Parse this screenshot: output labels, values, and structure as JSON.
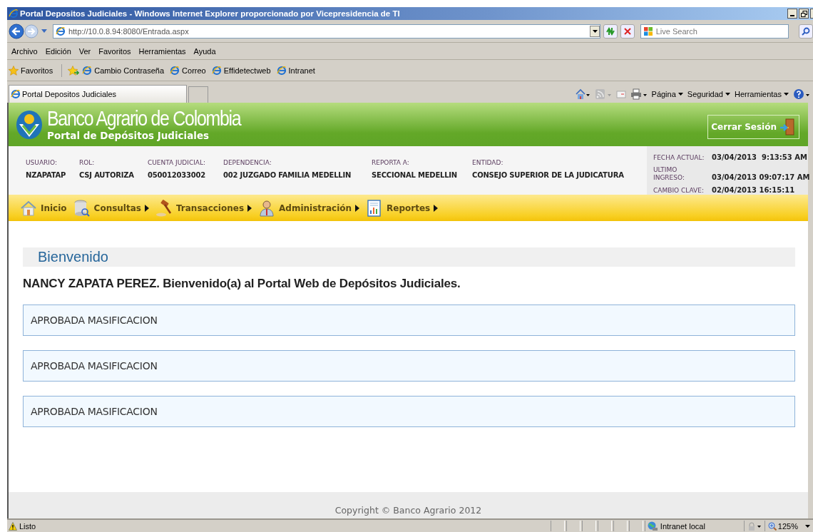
{
  "window": {
    "title": "Portal Depositos Judiciales - Windows Internet Explorer proporcionado por Vicepresidencia de TI"
  },
  "address_bar": {
    "url": "http://10.0.8.94:8080/Entrada.aspx"
  },
  "search": {
    "placeholder": "Live Search"
  },
  "menu_bar": [
    "Archivo",
    "Edición",
    "Ver",
    "Favoritos",
    "Herramientas",
    "Ayuda"
  ],
  "favorites_bar": {
    "label": "Favoritos",
    "links": [
      "Cambio Contraseña",
      "Correo",
      "Effidetectweb",
      "Intranet"
    ]
  },
  "tabs": [
    {
      "label": "Portal Depositos Judiciales",
      "selected": true
    }
  ],
  "command_bar": [
    "Página",
    "Seguridad",
    "Herramientas"
  ],
  "portal": {
    "bank_name": "Banco Agrario de Colombia",
    "subtitle": "Portal de Depósitos Judiciales",
    "logout": "Cerrar Sesión"
  },
  "user_info": [
    {
      "label": "USUARIO:",
      "value": "NZAPATAP"
    },
    {
      "label": "ROL:",
      "value": "CSJ AUTORIZA"
    },
    {
      "label": "CUENTA JUDICIAL:",
      "value": "050012033002"
    },
    {
      "label": "DEPENDENCIA:",
      "value": "002 JUZGADO FAMILIA MEDELLIN"
    },
    {
      "label": "REPORTA A:",
      "value": "SECCIONAL MEDELLIN"
    },
    {
      "label": "ENTIDAD:",
      "value": "CONSEJO SUPERIOR DE LA JUDICATURA"
    }
  ],
  "session_info": [
    {
      "label": "FECHA ACTUAL:",
      "value": "03/04/2013  9:13:53 AM"
    },
    {
      "label": "ULTIMO INGRESO:",
      "value": "03/04/2013 09:07:17 AM"
    },
    {
      "label": "CAMBIO CLAVE:",
      "value": "02/04/2013 16:15:11"
    }
  ],
  "nav": [
    {
      "kind": "home",
      "label": "Inicio",
      "has_submenu": false
    },
    {
      "kind": "database",
      "label": "Consultas",
      "has_submenu": true
    },
    {
      "kind": "gavel",
      "label": "Transacciones",
      "has_submenu": true
    },
    {
      "kind": "person",
      "label": "Administración",
      "has_submenu": true
    },
    {
      "kind": "report",
      "label": "Reportes",
      "has_submenu": true
    }
  ],
  "welcome": {
    "heading": "Bienvenido",
    "message": "NANCY ZAPATA PEREZ. Bienvenido(a) al Portal Web de Depósitos Judiciales.",
    "notices": [
      "APROBADA MASIFICACION",
      "APROBADA MASIFICACION",
      "APROBADA MASIFICACION"
    ]
  },
  "footer": {
    "copyright": "Copyright © Banco Agrario 2012"
  },
  "status_bar": {
    "text": "Listo",
    "zone": "Intranet local",
    "zoom": "125%"
  }
}
